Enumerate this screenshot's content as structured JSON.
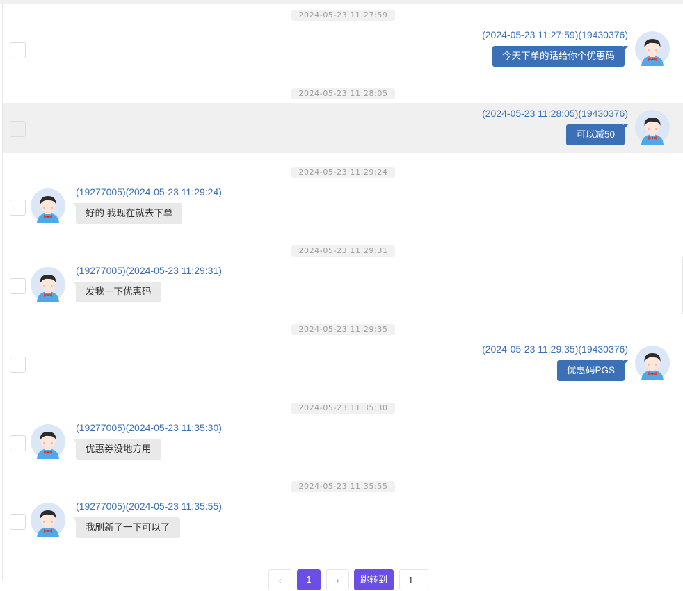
{
  "messages": [
    {
      "side": "right",
      "time": "2024-05-23 11:27:59",
      "meta": "(2024-05-23 11:27:59)(19430376)",
      "text": "今天下单的话给你个优惠码",
      "highlighted": false
    },
    {
      "side": "right",
      "time": "2024-05-23 11:28:05",
      "meta": "(2024-05-23 11:28:05)(19430376)",
      "text": "可以减50",
      "highlighted": true
    },
    {
      "side": "left",
      "time": "2024-05-23 11:29:24",
      "meta": "(19277005)(2024-05-23 11:29:24)",
      "text": "好的 我现在就去下单",
      "highlighted": false
    },
    {
      "side": "left",
      "time": "2024-05-23 11:29:31",
      "meta": "(19277005)(2024-05-23 11:29:31)",
      "text": "发我一下优惠码",
      "highlighted": false
    },
    {
      "side": "right",
      "time": "2024-05-23 11:29:35",
      "meta": "(2024-05-23 11:29:35)(19430376)",
      "text": "优惠码PGS",
      "highlighted": false
    },
    {
      "side": "left",
      "time": "2024-05-23 11:35:30",
      "meta": "(19277005)(2024-05-23 11:35:30)",
      "text": "优惠券没地方用",
      "highlighted": false
    },
    {
      "side": "left",
      "time": "2024-05-23 11:35:55",
      "meta": "(19277005)(2024-05-23 11:35:55)",
      "text": "我刷新了一下可以了",
      "highlighted": false
    }
  ],
  "pagination": {
    "prev_icon": "chevron-left-icon",
    "current_page": "1",
    "next_icon": "chevron-right-icon",
    "jump_label": "跳转到",
    "jump_value": "1"
  },
  "colors": {
    "accent": "#6b4ee6",
    "sent_bubble": "#3b6fb6",
    "meta_text": "#3a6fb5",
    "received_bubble": "#e9e9e9"
  }
}
